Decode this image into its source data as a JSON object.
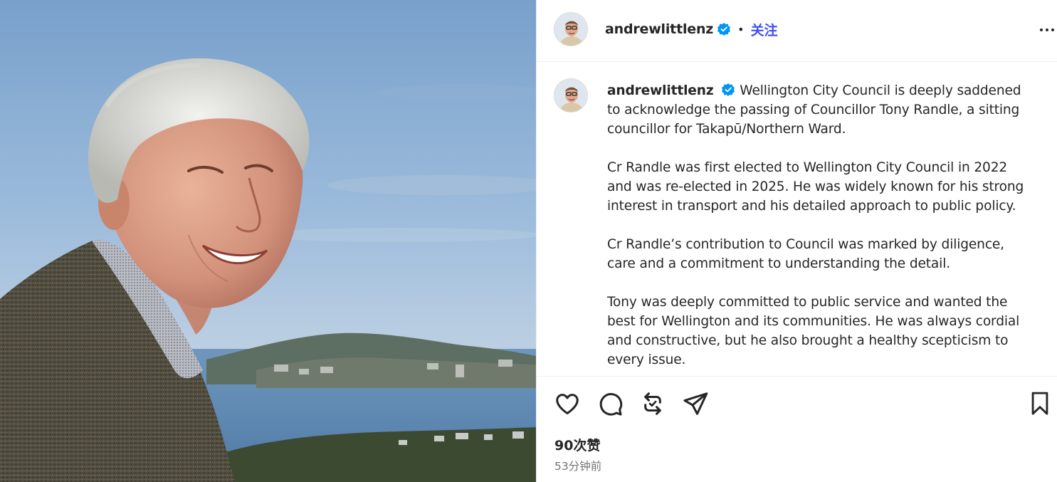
{
  "post": {
    "username": "andrewlittlenz",
    "follow_label": "关注",
    "separator": "•",
    "caption_paragraphs": [
      "Wellington City Council is deeply saddened to acknowledge the passing of Councillor Tony Randle, a sitting councillor for Takapū/Northern Ward.",
      "Cr Randle was first elected to Wellington City Council in 2022 and was re-elected in 2025. He was widely known for his strong interest in transport and his detailed approach to public policy.",
      "Cr Randle’s contribution to Council was marked by diligence, care and a commitment to understanding the detail.",
      "Tony was deeply committed to public service and wanted the best for Wellington and its communities. He was always cordial and constructive, but he also brought a healthy scepticism to every issue."
    ],
    "likes": "90次赞",
    "time_ago": "53分钟前"
  },
  "icons": {
    "verified": "verified-badge-icon",
    "more": "more-options-icon",
    "like": "heart-icon",
    "comment": "comment-bubble-icon",
    "repost": "repost-icon",
    "share": "send-icon",
    "save": "bookmark-icon"
  },
  "colors": {
    "follow": "#4150f7",
    "verified": "#0095f6",
    "text": "#262626",
    "muted": "#737373"
  }
}
